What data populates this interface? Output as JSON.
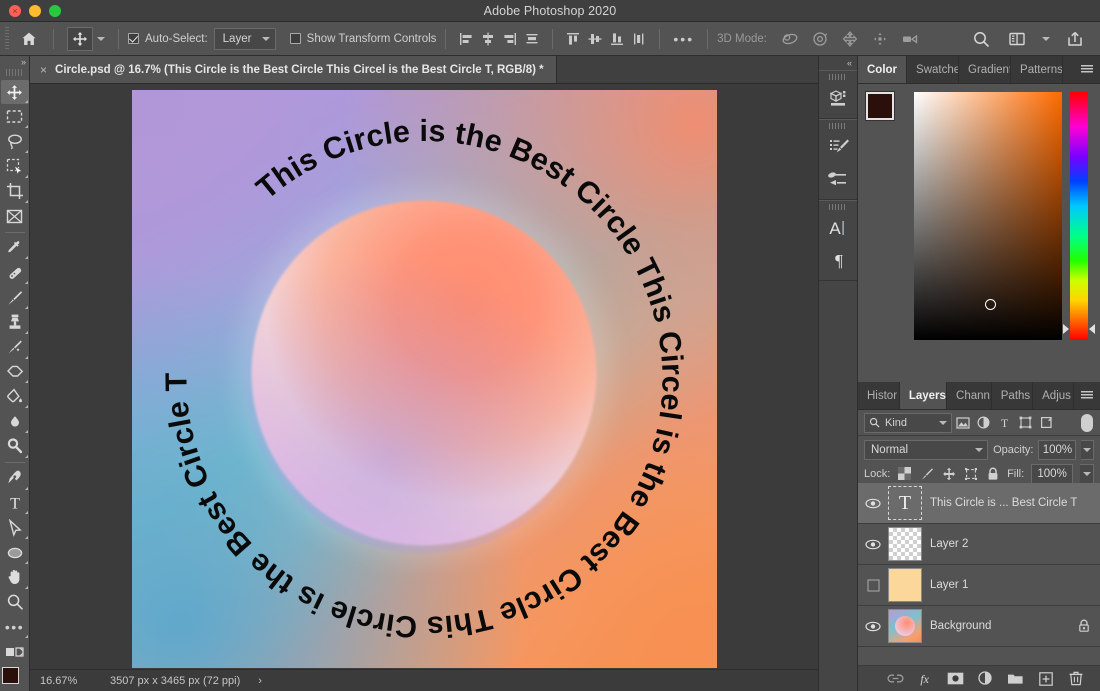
{
  "window": {
    "title": "Adobe Photoshop 2020",
    "traffic": {
      "close": "close-button",
      "minimize": "minimize-button",
      "maximize": "maximize-button"
    }
  },
  "options_bar": {
    "home_icon": "home-icon",
    "tool_icon": "move-tool-icon",
    "auto_select_checked": true,
    "auto_select_label": "Auto-Select:",
    "auto_select_value": "Layer",
    "show_transform_label": "Show Transform Controls",
    "show_transform_checked": false,
    "align_icons": [
      "align-left-edges-icon",
      "align-horizontal-centers-icon",
      "align-right-edges-icon",
      "distribute-horizontal-icon"
    ],
    "align_icons_2": [
      "align-top-edges-icon",
      "align-vertical-centers-icon",
      "align-bottom-edges-icon",
      "distribute-vertical-icon"
    ],
    "more_label": "•••",
    "mode3d_label": "3D Mode:",
    "mode3d_icons": [
      "orbit-3d-icon",
      "roll-3d-icon",
      "pan-3d-icon",
      "slide-3d-icon",
      "camera-3d-icon"
    ],
    "right_icons": [
      "search-icon",
      "workspace-icon",
      "chevron-down-icon",
      "share-icon"
    ]
  },
  "toolbar": {
    "collapse_label": "»",
    "tools": [
      {
        "name": "move-tool",
        "active": true
      },
      {
        "name": "rectangular-marquee-tool",
        "active": false
      },
      {
        "name": "lasso-tool",
        "active": false
      },
      {
        "name": "object-selection-tool",
        "active": false
      },
      {
        "name": "crop-tool",
        "active": false
      },
      {
        "name": "frame-tool",
        "active": false
      },
      {
        "name": "eyedropper-tool",
        "active": false
      },
      {
        "name": "spot-healing-brush-tool",
        "active": false
      },
      {
        "name": "brush-tool",
        "active": false
      },
      {
        "name": "clone-stamp-tool",
        "active": false
      },
      {
        "name": "history-brush-tool",
        "active": false
      },
      {
        "name": "eraser-tool",
        "active": false
      },
      {
        "name": "gradient-tool",
        "active": false
      },
      {
        "name": "blur-tool",
        "active": false
      },
      {
        "name": "dodge-tool",
        "active": false
      },
      {
        "name": "pen-tool",
        "active": false
      },
      {
        "name": "type-tool",
        "active": false
      },
      {
        "name": "path-selection-tool",
        "active": false
      },
      {
        "name": "ellipse-tool",
        "active": false
      },
      {
        "name": "hand-tool",
        "active": false
      },
      {
        "name": "zoom-tool",
        "active": false
      },
      {
        "name": "edit-toolbar-tool",
        "active": false
      }
    ],
    "quickmask_icon": "quick-mask-icon",
    "screenmode_icon": "screen-mode-icon",
    "foreground_color": "#2b0f0b",
    "background_color": "#f2f2f2"
  },
  "document": {
    "tab_label": "Circle.psd @ 16.7% (This Circle is the Best Circle This Circel is the Best Circle T, RGB/8) *",
    "tab_close": "×",
    "artwork": {
      "ring_text": "This Circle is the Best Circle This Circel is the Best Circle ",
      "gradient_top_left": "#b297d8",
      "gradient_top_right": "#ef8e72",
      "gradient_bottom_left": "#5fa8cc",
      "gradient_bottom_right": "#f79051",
      "orb_name": "gradient-sphere"
    }
  },
  "status_bar": {
    "zoom": "16.67%",
    "dimensions": "3507 px x 3465 px (72 ppi)",
    "arrow": "›"
  },
  "rail": {
    "collapse_label": "«",
    "groups": [
      {
        "icons": [
          "libraries-icon"
        ]
      },
      {
        "icons": [
          "brush-settings-icon",
          "brush-presets-icon"
        ]
      },
      {
        "icons": [
          "character-panel-icon",
          "paragraph-panel-icon"
        ]
      }
    ]
  },
  "color_panel": {
    "tabs": [
      {
        "label": "Color",
        "active": true
      },
      {
        "label": "Swatches",
        "active": false
      },
      {
        "label": "Gradient",
        "active": false
      },
      {
        "label": "Patterns",
        "active": false
      }
    ],
    "menu_icon": "panel-menu-icon",
    "foreground_color": "#2b0f0b",
    "background_color": "#f0efed",
    "field_name": "color-field",
    "hue_slider_name": "hue-slider"
  },
  "layers_panel": {
    "tabs": [
      {
        "label": "Histor",
        "active": false
      },
      {
        "label": "Layers",
        "active": true
      },
      {
        "label": "Chann",
        "active": false
      },
      {
        "label": "Paths",
        "active": false
      },
      {
        "label": "Adjus",
        "active": false
      }
    ],
    "menu_icon": "panel-menu-icon",
    "filter": {
      "kind_label": "Kind",
      "search_icon": "search-icon",
      "type_filters": [
        "filter-pixel-icon",
        "filter-adjustment-icon",
        "filter-type-icon",
        "filter-shape-icon",
        "filter-smartobject-icon"
      ],
      "toggle_name": "filter-enable-toggle"
    },
    "blend_mode": "Normal",
    "opacity_label": "Opacity:",
    "opacity_value": "100%",
    "lock_label": "Lock:",
    "lock_icons": [
      "lock-transparent-pixels-icon",
      "lock-image-pixels-icon",
      "lock-position-icon",
      "lock-artboard-nesting-icon",
      "lock-all-icon"
    ],
    "fill_label": "Fill:",
    "fill_value": "100%",
    "layers": [
      {
        "name": "This Circle is ... Best Circle T",
        "visible": true,
        "selected": true,
        "thumb": "text",
        "locked": false
      },
      {
        "name": "Layer 2",
        "visible": true,
        "selected": false,
        "thumb": "checker",
        "locked": false
      },
      {
        "name": "Layer 1",
        "visible": false,
        "selected": false,
        "thumb": "solid",
        "locked": false
      },
      {
        "name": "Background",
        "visible": true,
        "selected": false,
        "thumb": "background",
        "locked": true
      }
    ],
    "footer_icons": [
      "link-layers-icon",
      "layer-style-fx-icon",
      "add-layer-mask-icon",
      "new-adjustment-layer-icon",
      "new-group-icon",
      "new-layer-icon",
      "delete-layer-icon"
    ]
  }
}
